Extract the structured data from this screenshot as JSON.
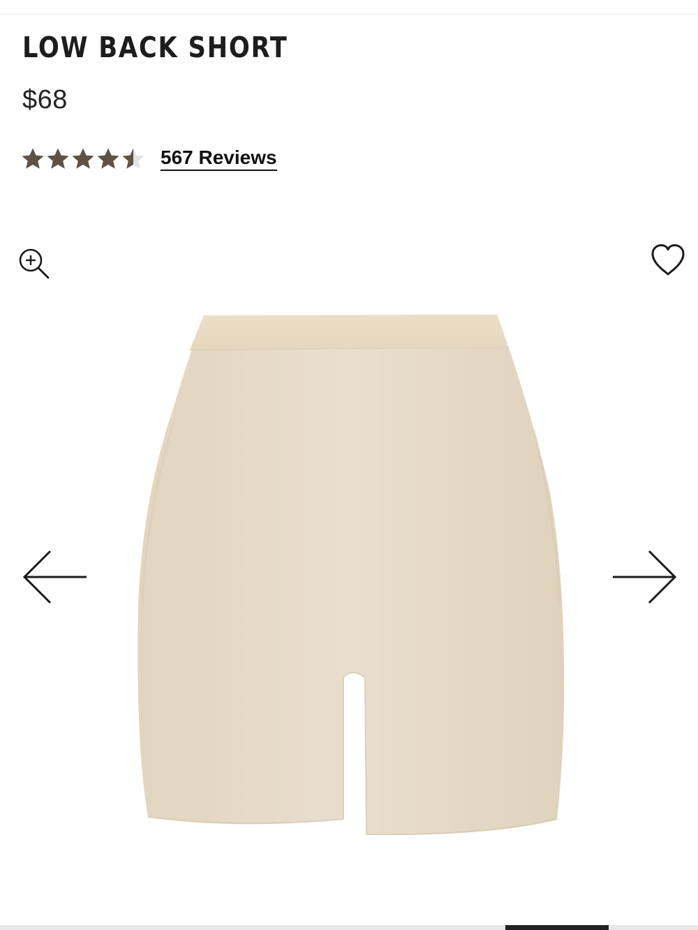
{
  "product": {
    "title": "LOW BACK SHORT",
    "price": "$68",
    "rating": {
      "value": 4.5,
      "max": 5,
      "reviews_label": "567 Reviews"
    },
    "image_alt": "Low Back Short in a nude colorway",
    "swatch_color": "#e5d8c4"
  },
  "icons": {
    "zoom": "zoom-in-icon",
    "favorite": "heart-icon",
    "prev": "arrow-left-icon",
    "next": "arrow-right-icon"
  },
  "colors": {
    "star_filled": "#5e5247",
    "star_empty": "#e3e3e3",
    "text": "#1d1d1d"
  },
  "gallery": {
    "active_indicator": "5"
  }
}
